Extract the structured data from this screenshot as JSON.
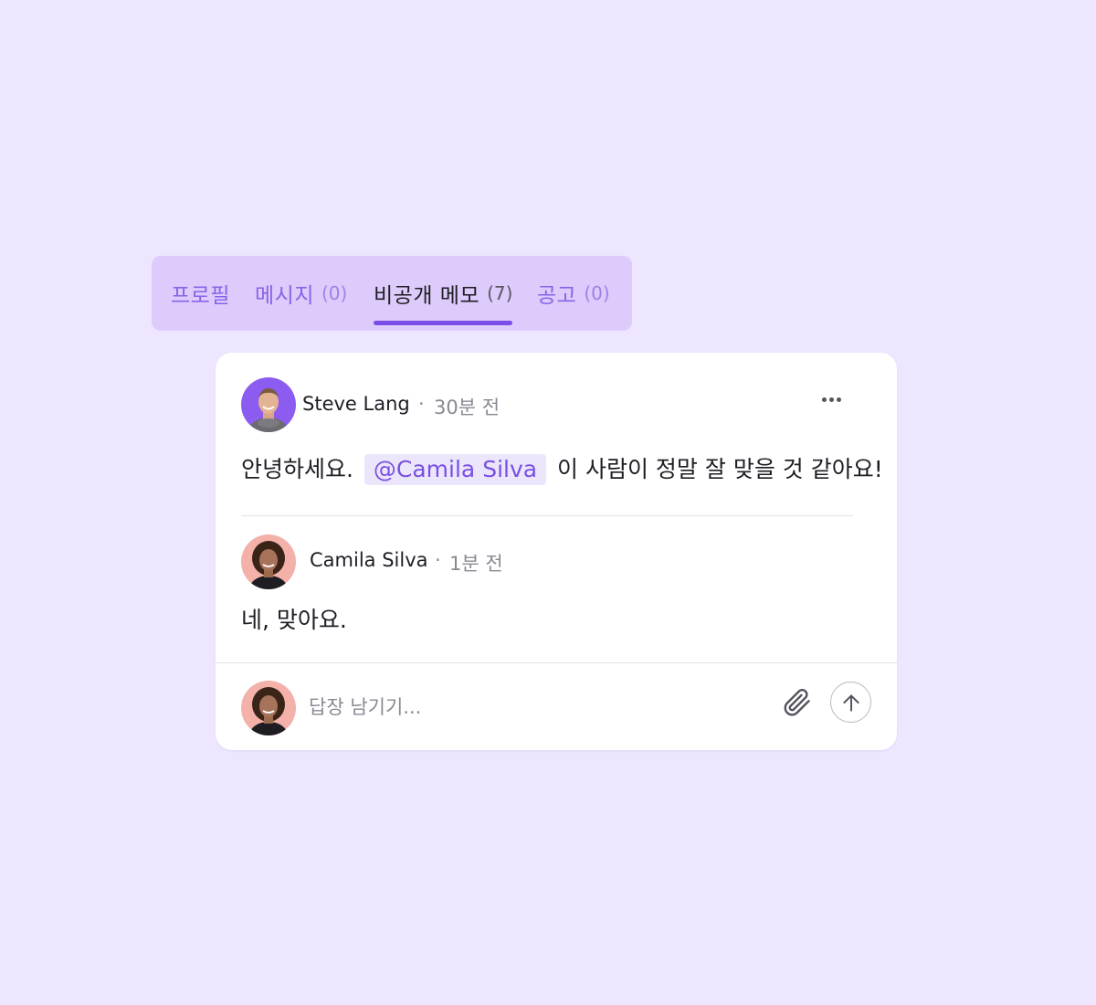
{
  "tabs": [
    {
      "label": "프로필",
      "count": ""
    },
    {
      "label": "메시지",
      "count": "(0)"
    },
    {
      "label": "비공개 메모",
      "count": "(7)",
      "active": true
    },
    {
      "label": "공고",
      "count": "(0)"
    }
  ],
  "note": {
    "author": "Steve Lang",
    "separator": "·",
    "time": "30분 전",
    "text_before": "안녕하세요.",
    "mention": "@Camila Silva",
    "text_after": "이 사람이 정말 잘 맞을 것 같아요!",
    "more_icon": "more-horizontal-icon"
  },
  "reply": {
    "author": "Camila Silva",
    "separator": "·",
    "time": "1분 전",
    "text": "네, 맞아요."
  },
  "composer": {
    "placeholder": "답장 남기기...",
    "attach_icon": "paperclip-icon",
    "send_icon": "arrow-up-icon"
  },
  "colors": {
    "background": "#ede6fe",
    "tabbar": "#dccbfb",
    "accent": "#7a4ee6",
    "mention_bg": "#ece6fd",
    "mention_text": "#7950e0"
  }
}
